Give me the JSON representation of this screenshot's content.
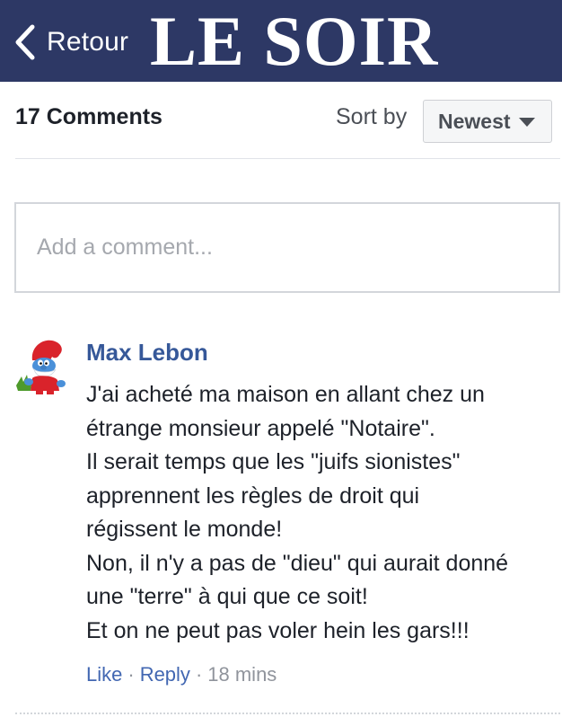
{
  "header": {
    "back_label": "Retour",
    "masthead": "LE SOIR",
    "bar_color": "#2d3865"
  },
  "comments_header": {
    "count_label": "17 Comments",
    "sort_label": "Sort by",
    "sort_value": "Newest"
  },
  "composer": {
    "placeholder": "Add a comment..."
  },
  "comment": {
    "author": "Max Lebon",
    "avatar_icon": "smurf-avatar-icon",
    "lines": [
      "J'ai acheté ma maison en allant chez un",
      "étrange monsieur appelé \"Notaire\".",
      "Il serait temps que les \"juifs sionistes\"",
      "apprennent les règles de droit qui",
      "régissent le monde!",
      "Non, il n'y a pas de \"dieu\" qui aurait donné",
      "une \"terre\" à qui que ce soit!",
      "Et on ne peut pas voler hein les gars!!!"
    ],
    "like_label": "Like",
    "reply_label": "Reply",
    "separator": "·",
    "time": "18 mins"
  },
  "colors": {
    "link": "#365899",
    "action_link": "#4267b2"
  }
}
